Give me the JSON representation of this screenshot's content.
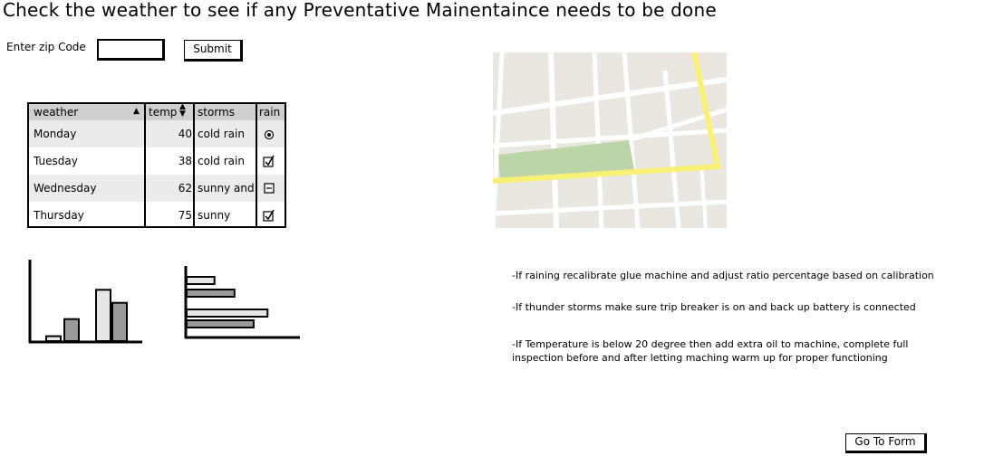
{
  "page": {
    "title": "Check the weather to see if any Preventative Mainentaince needs to be done"
  },
  "zip_form": {
    "label": "Enter zip Code",
    "input_value": "",
    "submit_label": "Submit"
  },
  "weather_table": {
    "headers": [
      "weather",
      "temp",
      "storms",
      "rain"
    ],
    "rows": [
      {
        "day": "Monday",
        "temp": "40",
        "storms": "cold rain",
        "rain": "radio-selected"
      },
      {
        "day": "Tuesday",
        "temp": "38",
        "storms": "cold rain",
        "rain": "checked"
      },
      {
        "day": "Wednesday",
        "temp": "62",
        "storms": "sunny and",
        "rain": "indeterminate"
      },
      {
        "day": "Thursday",
        "temp": "75",
        "storms": "sunny",
        "rain": "checked"
      }
    ]
  },
  "charts": {
    "column_chart": {
      "values": [
        0.06,
        0.27,
        0.63,
        0.47
      ]
    },
    "bar_chart": {
      "values": [
        0.32,
        0.55,
        0.93,
        0.77
      ]
    }
  },
  "colors": {
    "map_bg": "#e9e7e0",
    "map_park": "#bcd5a8",
    "map_highway": "#f8f176",
    "table_header": "#cfcfcf",
    "table_alt_row": "#ebebeb"
  },
  "notes": [
    "-If raining recalibrate glue machine and adjust ratio percentage based on calibration",
    "-If thunder storms make sure trip breaker is on and back up battery is connected",
    "-If Temperature is below 20 degree then add extra oil to machine, complete full",
    "inspection before and after letting maching warm up for proper functioning"
  ],
  "footer": {
    "go_to_form_label": "Go To Form"
  }
}
